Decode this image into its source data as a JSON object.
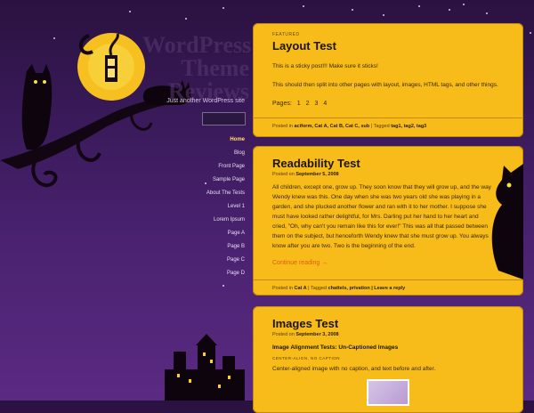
{
  "site": {
    "title_lines": [
      "WordPress",
      "Theme",
      "Reviews"
    ],
    "tagline": "Just another WordPress site"
  },
  "nav": [
    "Home",
    "Blog",
    "Front Page",
    "Sample Page",
    "About The Tests",
    "Level 1",
    "Lorem Ipsum",
    "Page A",
    "Page B",
    "Page C",
    "Page D"
  ],
  "posts": [
    {
      "kicker": "FEATURED",
      "title": "Layout Test",
      "p1": "This is a sticky post!!! Make sure it sticks!",
      "p2": "This should then split into other pages with layout, images, HTML tags, and other things.",
      "pages_label": "Pages:",
      "pages": [
        "1",
        "2",
        "3",
        "4"
      ],
      "meta_prefix": "Posted in",
      "meta_cats": "aciform, Cat A, Cat B, Cat C, sub",
      "meta_tag_label": "| Tagged",
      "meta_tags": "tag1, tag2, tag3"
    },
    {
      "title": "Readability Test",
      "date_prefix": "Posted on",
      "date": "September 5, 2008",
      "body": "All children, except one, grow up. They soon know that they will grow up, and the way Wendy knew was this. One day when she was two years old she was playing in a garden, and she plucked another flower and ran with it to her mother. I suppose she must have looked rather delightful, for Mrs. Darling put her hand to her heart and cried, \"Oh, why can't you remain like this for ever!\" This was all that passed between them on the subject, but henceforth Wendy knew that she must grow up. You always know after you are two. Two is the beginning of the end.",
      "more": "Continue reading →",
      "meta_prefix": "Posted in",
      "meta_cats": "Cat A",
      "meta_tag_label": "| Tagged",
      "meta_tags": "chattels, privation",
      "meta_reply": "| Leave a reply"
    },
    {
      "title": "Images Test",
      "date_prefix": "Posted on",
      "date": "September 3, 2008",
      "subhead": "Image Alignment Tests: Un-Captioned Images",
      "caption_label": "CENTER-ALIGN, NO CAPTION",
      "caption_text": "Center-aligned image with no caption, and text before and after."
    }
  ]
}
